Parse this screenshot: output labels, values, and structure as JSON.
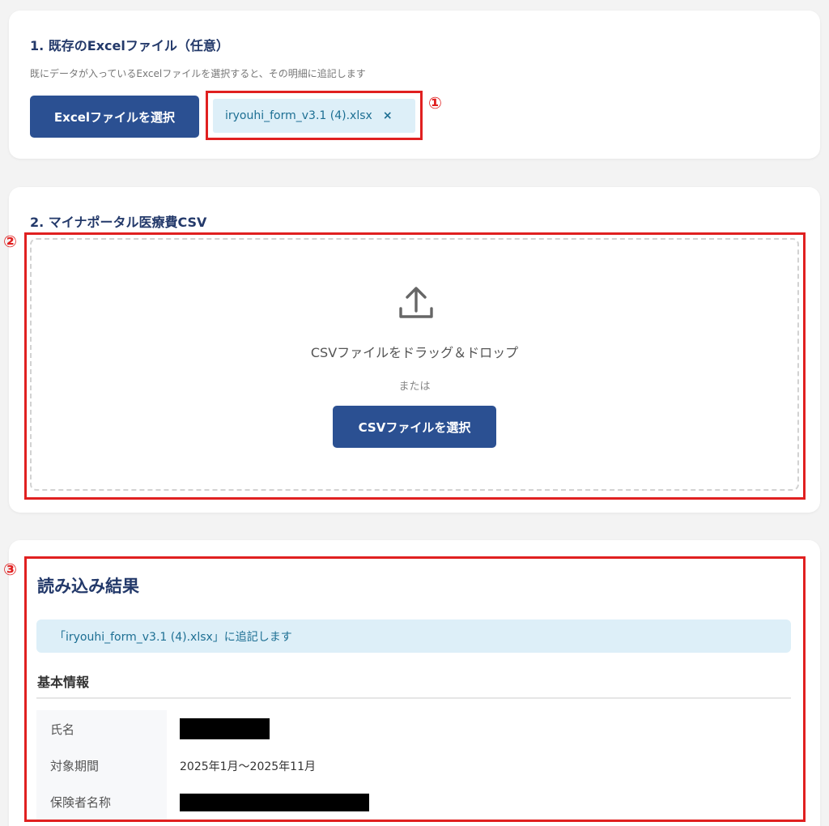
{
  "excel_section": {
    "title": "1. 既存のExcelファイル（任意）",
    "description": "既にデータが入っているExcelファイルを選択すると、その明細に追記します",
    "select_button": "Excelファイルを選択",
    "selected_file": "iryouhi_form_v3.1 (4).xlsx",
    "remove_symbol": "×"
  },
  "csv_section": {
    "title": "2. マイナポータル医療費CSV",
    "drop_text": "CSVファイルをドラッグ＆ドロップ",
    "or_text": "または",
    "select_button": "CSVファイルを選択",
    "icon": "upload-icon"
  },
  "result_section": {
    "title": "読み込み結果",
    "banner": "「iryouhi_form_v3.1 (4).xlsx」に追記します",
    "basic_info_heading": "基本情報",
    "rows": [
      {
        "label": "氏名",
        "value": "",
        "redacted": true
      },
      {
        "label": "対象期間",
        "value": "2025年1月〜2025年11月",
        "redacted": false
      },
      {
        "label": "保険者名称",
        "value": "",
        "redacted": true
      }
    ]
  },
  "annotations": {
    "marker_1": "①",
    "marker_2": "②",
    "marker_3": "③",
    "color": "#e02020"
  },
  "colors": {
    "primary": "#2b5092",
    "heading": "#23396a",
    "info_bg": "#ddeff8",
    "info_text": "#1d6f93"
  }
}
